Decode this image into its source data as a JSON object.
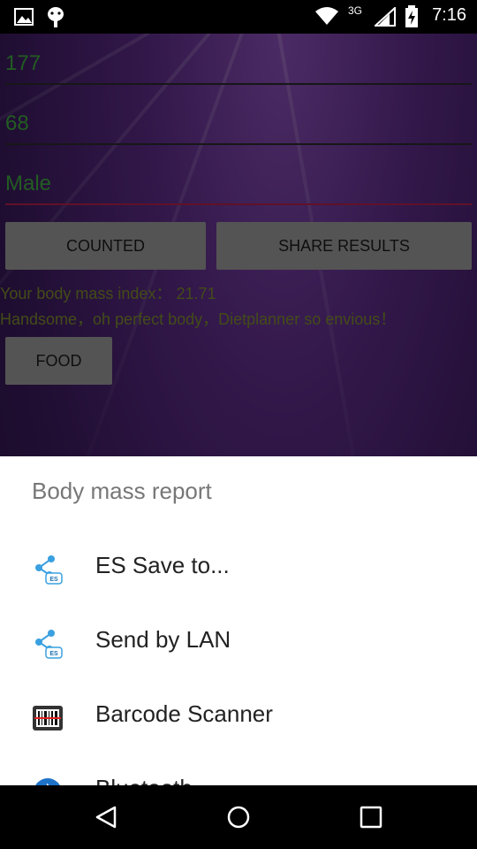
{
  "status_bar": {
    "time": "7:16",
    "network": "3G"
  },
  "form": {
    "height_value": "177",
    "weight_value": "68",
    "gender_value": "Male"
  },
  "buttons": {
    "counted": "COUNTED",
    "share_results": "SHARE RESULTS",
    "food": "FOOD"
  },
  "result": {
    "bmi_line": "Your body mass index：  21.71",
    "comment": "Handsome，oh perfect body，Dietplanner so envious！"
  },
  "share_sheet": {
    "title": "Body mass report",
    "items": [
      {
        "label": "ES Save to...",
        "icon": "es-share-icon"
      },
      {
        "label": "Send by LAN",
        "icon": "es-share-icon"
      },
      {
        "label": "Barcode Scanner",
        "icon": "barcode-scanner-icon"
      },
      {
        "label": "Bluetooth",
        "icon": "bluetooth-icon"
      }
    ]
  },
  "colors": {
    "input_text": "#3fa83f",
    "accent_underline": "#b0204a",
    "result_text": "#7a8a2a"
  }
}
